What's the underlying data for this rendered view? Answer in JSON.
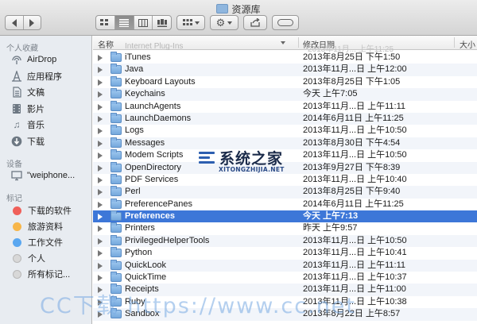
{
  "window": {
    "title": "资源库"
  },
  "toolbar": {
    "view_modes": [
      "icon",
      "list",
      "column",
      "coverflow"
    ],
    "active_view": "list"
  },
  "sidebar": {
    "favorites_header": "个人收藏",
    "favorites": [
      {
        "label": "AirDrop",
        "icon": "airdrop-icon"
      },
      {
        "label": "应用程序",
        "icon": "applications-icon"
      },
      {
        "label": "文稿",
        "icon": "documents-icon"
      },
      {
        "label": "影片",
        "icon": "movies-icon"
      },
      {
        "label": "音乐",
        "icon": "music-icon"
      },
      {
        "label": "下载",
        "icon": "downloads-icon"
      }
    ],
    "devices_header": "设备",
    "devices": [
      {
        "label": "\"weiphone...",
        "icon": "computer-icon"
      }
    ],
    "tags_header": "标记",
    "tags": [
      {
        "label": "下载的软件",
        "color": "#f0605a"
      },
      {
        "label": "旅游资料",
        "color": "#f7b64a"
      },
      {
        "label": "工作文件",
        "color": "#5aa7f0"
      },
      {
        "label": "个人",
        "color": "#d8d8d8"
      },
      {
        "label": "所有标记...",
        "color": "#d8d8d8"
      }
    ]
  },
  "list": {
    "columns": {
      "name": "名称",
      "date": "修改日期",
      "size": "大小"
    },
    "ghost_name": "Internet Plug-Ins",
    "ghost_date": "2013年11月... 上午11:25",
    "rows": [
      {
        "name": "iTunes",
        "date": "2013年8月25日 下午1:50"
      },
      {
        "name": "Java",
        "date": "2013年11月...日 上午12:00"
      },
      {
        "name": "Keyboard Layouts",
        "date": "2013年8月25日 下午1:05"
      },
      {
        "name": "Keychains",
        "date": "今天 上午7:05"
      },
      {
        "name": "LaunchAgents",
        "date": "2013年11月...日 上午11:11"
      },
      {
        "name": "LaunchDaemons",
        "date": "2014年6月11日 上午11:25"
      },
      {
        "name": "Logs",
        "date": "2013年11月...日 上午10:50"
      },
      {
        "name": "Messages",
        "date": "2013年8月30日 下午4:54"
      },
      {
        "name": "Modem Scripts",
        "date": "2013年11月...日 上午10:50"
      },
      {
        "name": "OpenDirectory",
        "date": "2013年9月27日 下午8:39"
      },
      {
        "name": "PDF Services",
        "date": "2013年11月...日 上午10:40"
      },
      {
        "name": "Perl",
        "date": "2013年8月25日 下午9:40"
      },
      {
        "name": "PreferencePanes",
        "date": "2014年6月11日 上午11:25"
      },
      {
        "name": "Preferences",
        "date": "今天 上午7:13",
        "selected": true
      },
      {
        "name": "Printers",
        "date": "昨天 上午9:57"
      },
      {
        "name": "PrivilegedHelperTools",
        "date": "2013年11月...日 上午10:50"
      },
      {
        "name": "Python",
        "date": "2013年11月...日 上午10:41"
      },
      {
        "name": "QuickLook",
        "date": "2013年11月...日 上午11:11"
      },
      {
        "name": "QuickTime",
        "date": "2013年11月...日 上午10:37"
      },
      {
        "name": "Receipts",
        "date": "2013年11月...日 上午11:00"
      },
      {
        "name": "Ruby",
        "date": "2013年11月...日 上午10:38"
      },
      {
        "name": "Sandbox",
        "date": "2013年8月22日 上午8:57"
      }
    ]
  },
  "watermark": {
    "site_name": "系统之家",
    "site_domain": "XITONGZHIJIA.NET",
    "bottom_text": "CC下载 https://www.cc.net"
  }
}
